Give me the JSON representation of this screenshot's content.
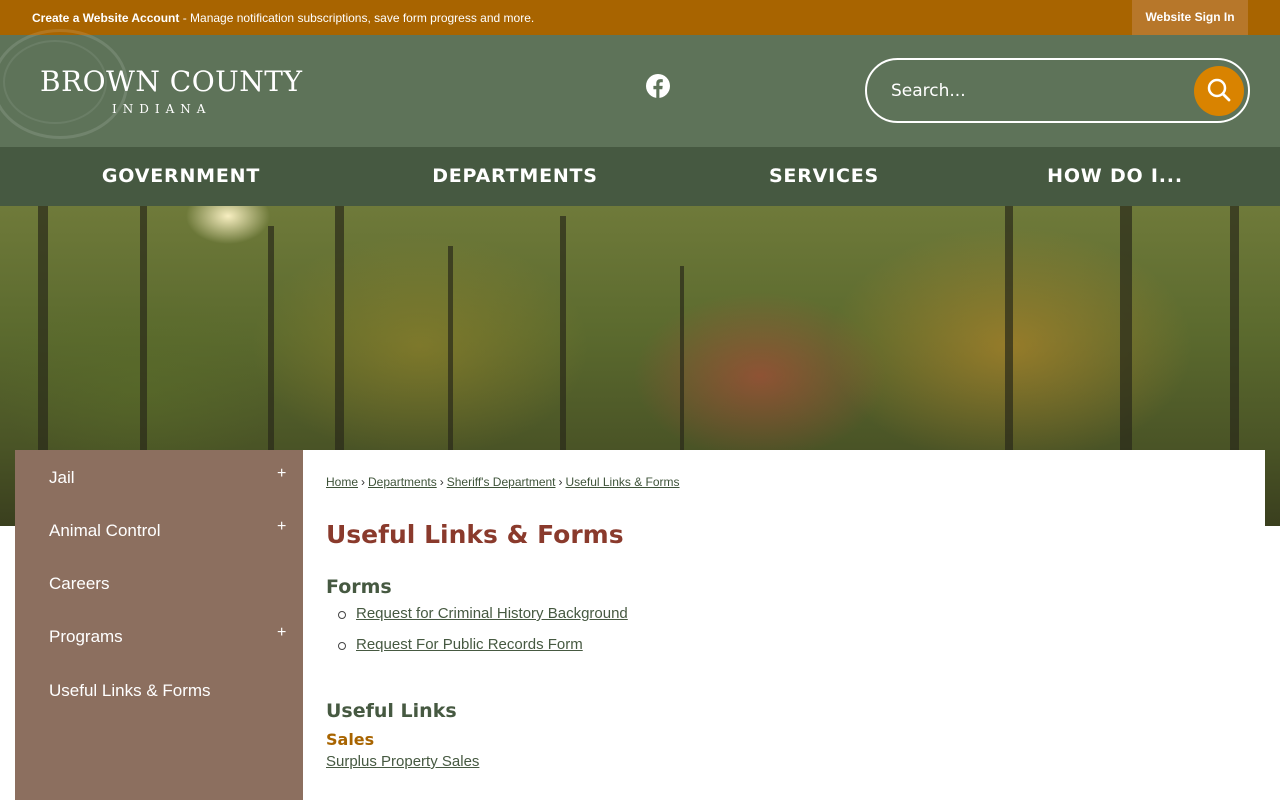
{
  "top_bar": {
    "account_link": "Create a Website Account",
    "account_desc": " - Manage notification subscriptions, save form progress and more.",
    "sign_in": "Website Sign In"
  },
  "header": {
    "logo_title": "BROWN COUNTY",
    "logo_subtitle": "INDIANA",
    "search_placeholder": "Search..."
  },
  "nav": {
    "items": [
      "GOVERNMENT",
      "DEPARTMENTS",
      "SERVICES",
      "HOW DO I..."
    ]
  },
  "sidebar": {
    "items": [
      {
        "label": "Jail",
        "expandable": true
      },
      {
        "label": "Animal Control",
        "expandable": true
      },
      {
        "label": "Careers",
        "expandable": false
      },
      {
        "label": "Programs",
        "expandable": true
      },
      {
        "label": "Useful Links & Forms",
        "expandable": false
      }
    ],
    "expand_symbol": "+"
  },
  "breadcrumb": [
    "Home",
    "Departments",
    "Sheriff's Department",
    "Useful Links & Forms"
  ],
  "breadcrumb_sep": "›",
  "main": {
    "title": "Useful Links & Forms",
    "forms_heading": "Forms",
    "forms": [
      "Request for Criminal History Background",
      "Request For Public Records Form"
    ],
    "links_heading": "Useful Links",
    "sales_heading": "Sales",
    "sales_link": "Surplus Property Sales"
  },
  "colors": {
    "top_bar": "#a86400",
    "header": "#5e7359",
    "nav": "#465941",
    "sidebar": "#8c6f5f",
    "title": "#8a3a2c",
    "accent": "#d98300"
  },
  "icons": [
    "facebook-icon",
    "search-icon",
    "expand-plus-icon"
  ]
}
